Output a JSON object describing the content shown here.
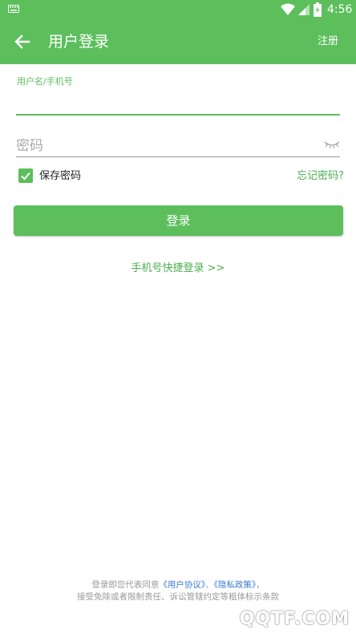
{
  "status_bar": {
    "time": "4:56",
    "icons": [
      "keyboard-icon",
      "wifi-icon",
      "signal-icon",
      "battery-icon"
    ]
  },
  "app_bar": {
    "title": "用户登录",
    "register": "注册",
    "icons": [
      "back-arrow-icon"
    ]
  },
  "form": {
    "username_label": "用户名/手机号",
    "username_value": "",
    "password_placeholder": "密码",
    "password_value": "",
    "remember_label": "保存密码",
    "remember_checked": true,
    "forgot": "忘记密码?",
    "login_button": "登录",
    "quick_login": "手机号快捷登录 >>",
    "icons": [
      "eye-closed-icon",
      "check-icon"
    ]
  },
  "footer": {
    "prefix": "登录即您代表同意",
    "user_agreement": "《用户协议》",
    "separator": "、",
    "privacy_policy": "《隐私政策》",
    "suffix": "，",
    "line2": "接受免除或者限制责任、诉讼管辖约定等粗体标示条款"
  },
  "watermark": "QQTF.COM",
  "colors": {
    "accent": "#5cbf5c",
    "link_green": "#4caf50",
    "link_blue": "#3a7bd5"
  }
}
